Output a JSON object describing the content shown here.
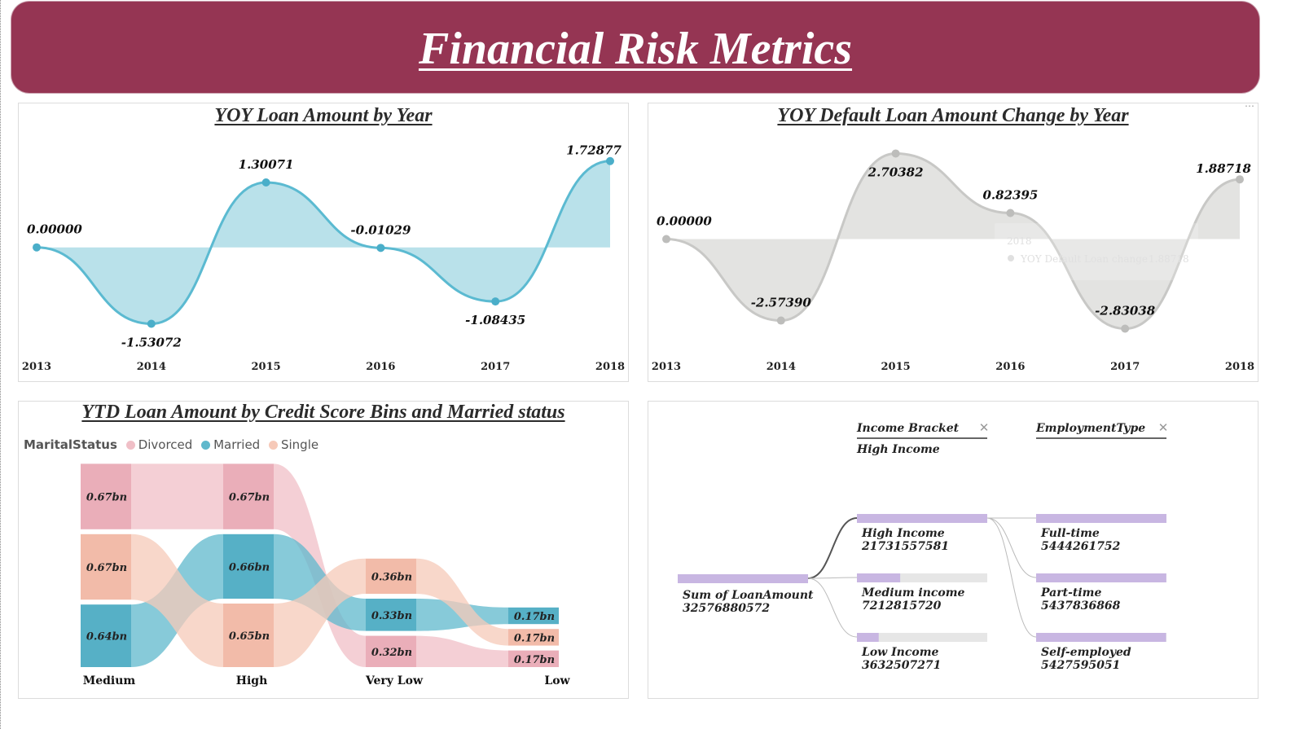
{
  "header": {
    "title": "Financial Risk Metrics"
  },
  "colors": {
    "header_bg": "#953553",
    "blue": "#5bbad1",
    "blue_fill": "#b9e1ea",
    "gray": "#c8c8c6",
    "gray_fill": "#e3e3e1",
    "divorced": "#f0bfc7",
    "married": "#5fb8cc",
    "single": "#f6c9b8",
    "decomp_bar": "#c8b6e2",
    "decomp_track": "#e6e6e6"
  },
  "chart_data": [
    {
      "type": "area",
      "title": "YOY Loan Amount by Year",
      "x": [
        "2013",
        "2014",
        "2015",
        "2016",
        "2017",
        "2018"
      ],
      "series": [
        {
          "values": [
            0.0,
            -1.53072,
            1.30071,
            -0.01029,
            -1.08435,
            1.72877
          ]
        }
      ],
      "labels": [
        "0.00000",
        "-1.53072",
        "1.30071",
        "-0.01029",
        "-1.08435",
        "1.72877"
      ],
      "ylim": [
        -1.8,
        2.1
      ]
    },
    {
      "type": "area",
      "title": "YOY Default Loan Amount Change by Year",
      "x": [
        "2013",
        "2014",
        "2015",
        "2016",
        "2017",
        "2018"
      ],
      "series": [
        {
          "values": [
            0.0,
            -2.5739,
            2.70382,
            0.82395,
            -2.83038,
            1.88718
          ]
        }
      ],
      "labels": [
        "0.00000",
        "-2.57390",
        "2.70382",
        "0.82395",
        "-2.83038",
        "1.88718"
      ],
      "ylim": [
        -3.1,
        3.05
      ],
      "tooltip": {
        "year": "2018",
        "series": "YOY Default Loan change",
        "value": "1.88718"
      }
    },
    {
      "type": "ribbon",
      "title": "YTD Loan Amount by Credit Score Bins and Married status",
      "legend_title": "MaritalStatus",
      "legend": [
        "Divorced",
        "Married",
        "Single"
      ],
      "categories": [
        "Medium",
        "High",
        "Very Low",
        "Low"
      ],
      "series": [
        {
          "name": "Divorced",
          "values": [
            0.67,
            0.67,
            0.32,
            0.17
          ],
          "labels": [
            "0.67bn",
            "0.67bn",
            "0.32bn",
            "0.17bn"
          ]
        },
        {
          "name": "Married",
          "values": [
            0.64,
            0.66,
            0.33,
            0.17
          ],
          "labels": [
            "0.64bn",
            "0.66bn",
            "0.33bn",
            "0.17bn"
          ]
        },
        {
          "name": "Single",
          "values": [
            0.67,
            0.65,
            0.36,
            0.17
          ],
          "labels": [
            "0.67bn",
            "0.65bn",
            "0.36bn",
            "0.17bn"
          ]
        }
      ],
      "order": [
        [
          "Divorced",
          "Single",
          "Married"
        ],
        [
          "Divorced",
          "Married",
          "Single"
        ],
        [
          "Single",
          "Married",
          "Divorced"
        ],
        [
          "Married",
          "Single",
          "Divorced"
        ]
      ]
    },
    {
      "type": "decomposition_tree",
      "levels": [
        {
          "header": "Income Bracket",
          "selected": "High Income"
        },
        {
          "header": "EmploymentType",
          "selected": ""
        }
      ],
      "root": {
        "label": "Sum of LoanAmount",
        "value": 32576880572
      },
      "level1": [
        {
          "label": "High Income",
          "value": 21731557581,
          "selected": true
        },
        {
          "label": "Medium income",
          "value": 7212815720
        },
        {
          "label": "Low Income",
          "value": 3632507271
        }
      ],
      "level2": [
        {
          "label": "Full-time",
          "value": 5444261752
        },
        {
          "label": "Part-time",
          "value": 5437836868
        },
        {
          "label": "Self-employed",
          "value": 5427595051
        }
      ]
    }
  ]
}
